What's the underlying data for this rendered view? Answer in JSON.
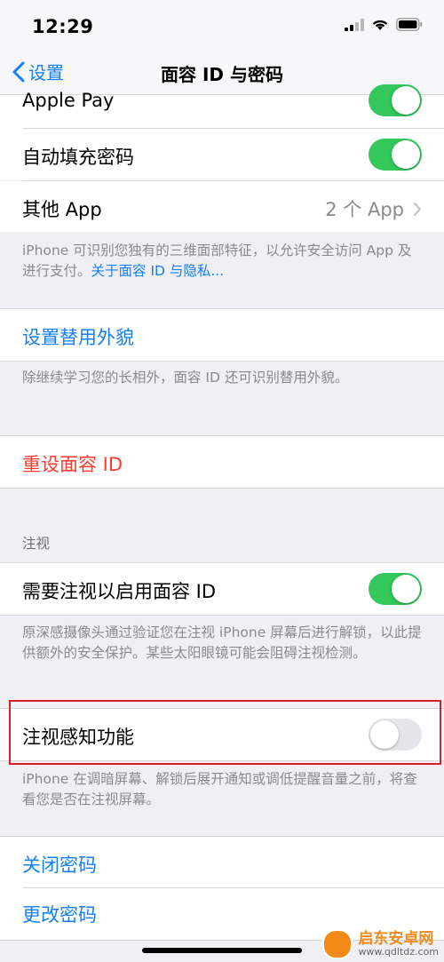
{
  "status": {
    "time": "12:29"
  },
  "nav": {
    "back_label": "设置",
    "title": "面容 ID 与密码"
  },
  "rows": {
    "apple_pay": {
      "label": "Apple Pay",
      "toggle": true
    },
    "autofill": {
      "label": "自动填充密码",
      "toggle": true
    },
    "other_app": {
      "label": "其他 App",
      "value": "2 个 App"
    }
  },
  "notes": {
    "faceid_text": "iPhone 可识别您独有的三维面部特征，以允许安全访问 App 及进行支付。",
    "faceid_link": "关于面容 ID 与隐私...",
    "alt_appearance": "除继续学习您的长相外，面容 ID 还可识别替用外貌。",
    "attention_required": "原深感摄像头通过验证您在注视 iPhone 屏幕后进行解锁，以此提供额外的安全保护。某些太阳眼镜可能会阻碍注视检测。",
    "attention_aware": "iPhone 在调暗屏幕、解锁后展开通知或调低提醒音量之前，将查看您是否在注视屏幕。"
  },
  "actions": {
    "set_alt_appearance": "设置替用外貌",
    "reset_faceid": "重设面容 ID",
    "turn_off_passcode": "关闭密码",
    "change_passcode": "更改密码"
  },
  "attention": {
    "section_header": "注视",
    "require_attention": {
      "label": "需要注视以启用面容 ID",
      "toggle": true
    },
    "attention_aware": {
      "label": "注视感知功能",
      "toggle": false
    }
  },
  "watermark": {
    "main": "启东安卓网",
    "sub": "www.qdltdz.com"
  },
  "colors": {
    "accent": "#147efb",
    "destructive": "#ff3b30",
    "toggle_on": "#34c759",
    "highlight_box": "#d3202a"
  }
}
